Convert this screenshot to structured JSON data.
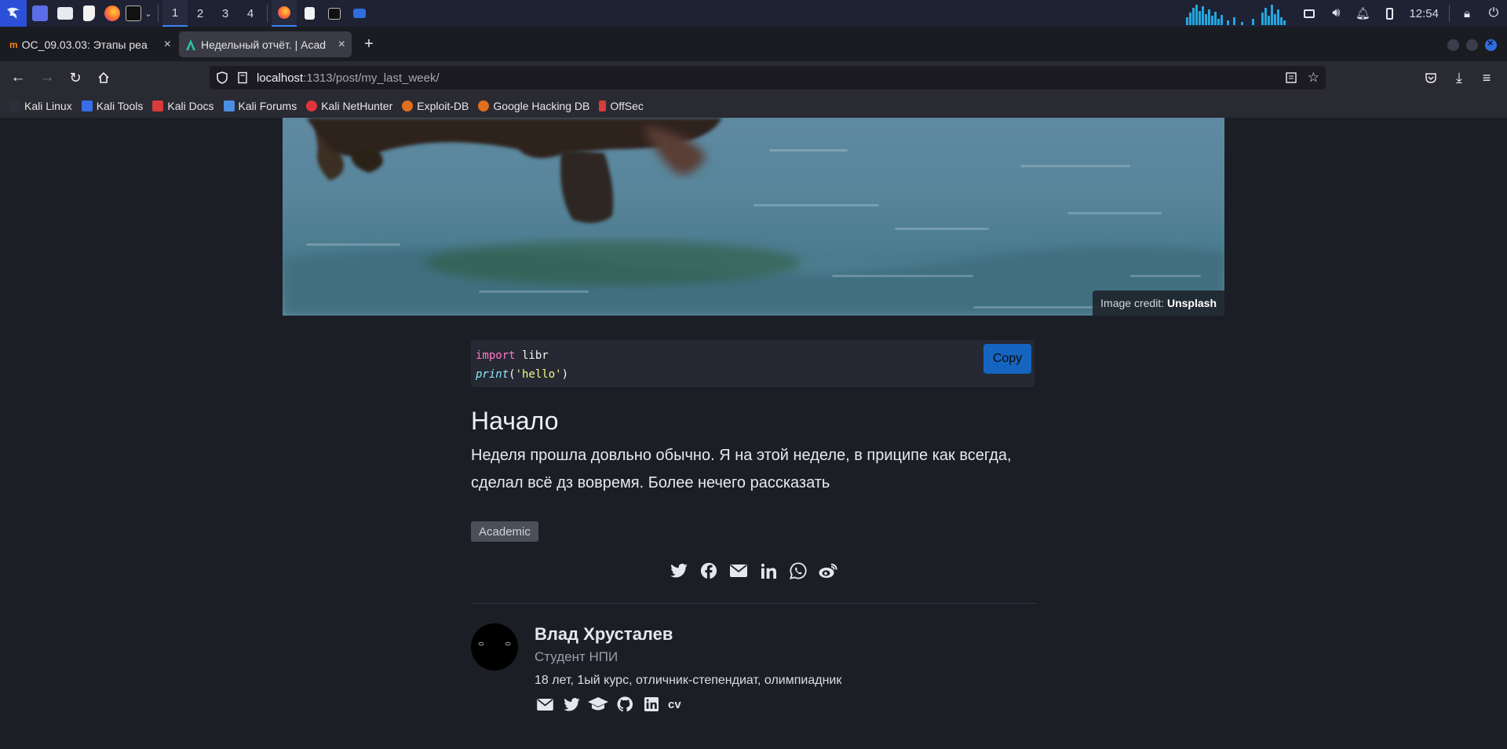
{
  "taskbar": {
    "workspaces": [
      "1",
      "2",
      "3",
      "4"
    ],
    "clock": "12:54"
  },
  "tabs": [
    {
      "title": "ОС_09.03.03: Этапы реа",
      "icon": "moodle-icon",
      "active": false
    },
    {
      "title": "Недельный отчёт. | Acad",
      "icon": "academic-icon",
      "active": true
    }
  ],
  "url": {
    "host": "localhost",
    "path": ":1313/post/my_last_week/"
  },
  "bookmarks": [
    {
      "label": "Kali Linux",
      "color": "#2b2f3a"
    },
    {
      "label": "Kali Tools",
      "color": "#3a6ee8"
    },
    {
      "label": "Kali Docs",
      "color": "#d83b3b"
    },
    {
      "label": "Kali Forums",
      "color": "#4a8fe0"
    },
    {
      "label": "Kali NetHunter",
      "color": "#e0353b"
    },
    {
      "label": "Exploit-DB",
      "color": "#e0701f"
    },
    {
      "label": "Google Hacking DB",
      "color": "#e0701f"
    },
    {
      "label": "OffSec",
      "color": "#d83b3b"
    }
  ],
  "hero": {
    "credit_prefix": "Image credit: ",
    "credit_source": "Unsplash"
  },
  "code": {
    "line1_kw": "import",
    "line1_rest": " libr",
    "line2_fn": "print",
    "line2_open": "(",
    "line2_str": "'hello'",
    "line2_close": ")",
    "copy_label": "Copy"
  },
  "article": {
    "heading": "Начало",
    "paragraph": "Неделя прошла довльно обычно. Я на этой неделе, в приципе как всегда, сделал всё дз вовремя. Более нечего рассказать",
    "tag": "Academic"
  },
  "share": [
    "twitter-icon",
    "facebook-icon",
    "email-icon",
    "linkedin-icon",
    "whatsapp-icon",
    "weibo-icon"
  ],
  "author": {
    "name": "Влад Хрусталев",
    "role": "Студент НПИ",
    "bio": "18 лет, 1ый курс, отличник-степендиат, олимпиадник",
    "links": [
      "email-icon",
      "twitter-icon",
      "graduation-cap-icon",
      "github-icon",
      "linkedin-icon"
    ],
    "cv": "cv"
  }
}
